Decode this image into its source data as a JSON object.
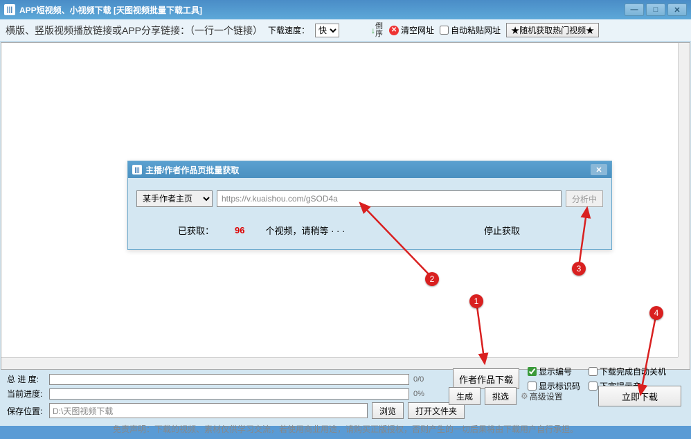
{
  "titlebar": {
    "title": "APP短视频、小视频下载 [天图视频批量下载工具]"
  },
  "toolbar": {
    "main_label": "横版、竖版视频播放链接或APP分享链接：（一行一个链接）",
    "speed_label": "下载速度：",
    "speed_value": "快",
    "sort_label": "倒序",
    "clear_label": "清空网址",
    "auto_paste_label": "自动粘贴网址",
    "random_btn": "★随机获取热门视频★"
  },
  "dialog": {
    "title": "主播/作者作品页批量获取",
    "author_select": "某手作者主页",
    "url_placeholder": "https://v.kuaishou.com/gSOD4a",
    "analyze_btn": "分析中",
    "fetched_label": "已获取：",
    "count": "96",
    "wait_label": "个视频，请稍等 · · ·",
    "stop_label": "停止获取"
  },
  "bottom": {
    "total_progress_label": "总 进 度:",
    "total_progress_text": "0/0",
    "current_progress_label": "当前进度:",
    "current_progress_text": "0%",
    "save_label": "保存位置:",
    "save_path": "D:\\天图视频下载",
    "browse_btn": "浏览",
    "open_folder_btn": "打开文件夹",
    "author_download_btn": "作者作品下载",
    "show_number_label": "显示编号",
    "show_id_label": "显示标识码",
    "finish_shutdown_label": "下载完成自动关机",
    "incomplete_tip_label": "下完提示音",
    "generate_btn": "生成",
    "pick_btn": "挑选",
    "advanced_label": "高级设置",
    "download_now_btn": "立即下载",
    "disclaimer": "免责声明：下载的视频、素材仅供学习交流，若使用商业用途，请购买正版授权，否则产生的一切后果将由下载用户自行承担。"
  }
}
